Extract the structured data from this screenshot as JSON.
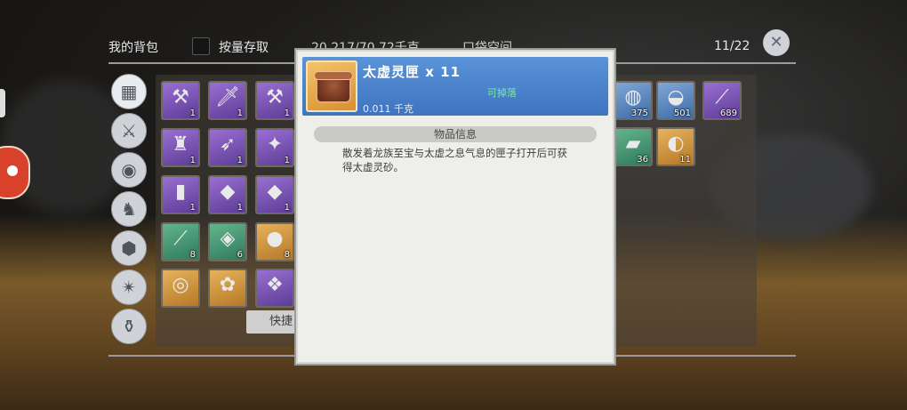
{
  "header": {
    "title": "我的背包",
    "check_label": "按量存取",
    "weight": "20.217/70.72千克",
    "capacity": "口袋空间",
    "count": "11/22",
    "close_icon": "close-x-icon"
  },
  "categories": [
    {
      "name": "all",
      "icon": "grid-icon",
      "glyph": "▦"
    },
    {
      "name": "weapon",
      "icon": "weapon-icon",
      "glyph": "⚔"
    },
    {
      "name": "food",
      "icon": "meat-icon",
      "glyph": "◉"
    },
    {
      "name": "mount",
      "icon": "horse-icon",
      "glyph": "♞"
    },
    {
      "name": "material",
      "icon": "stone-icon",
      "glyph": "⬢"
    },
    {
      "name": "gem",
      "icon": "crystal-icon",
      "glyph": "✴"
    },
    {
      "name": "bag",
      "icon": "bag-icon",
      "glyph": "⚱"
    }
  ],
  "inventory": [
    {
      "icon": "double-axe-icon",
      "glyph": "⚒",
      "qty": "1",
      "rarity": "purple"
    },
    {
      "icon": "greatsword-icon",
      "glyph": "🗡",
      "qty": "1",
      "rarity": "purple"
    },
    {
      "icon": "axe-icon",
      "glyph": "⚒",
      "qty": "1",
      "rarity": "purple"
    },
    {
      "icon": "tower-icon",
      "glyph": "♜",
      "qty": "1",
      "rarity": "purple"
    },
    {
      "icon": "bow-icon",
      "glyph": "➶",
      "qty": "1",
      "rarity": "purple"
    },
    {
      "icon": "staff-icon",
      "glyph": "✦",
      "qty": "1",
      "rarity": "purple"
    },
    {
      "icon": "leg-armor-icon",
      "glyph": "▮",
      "qty": "1",
      "rarity": "purple"
    },
    {
      "icon": "purple-gem-icon",
      "glyph": "◆",
      "qty": "1",
      "rarity": "purple"
    },
    {
      "icon": "purple-gem-icon",
      "glyph": "◆",
      "qty": "1",
      "rarity": "purple"
    },
    {
      "icon": "spear-icon",
      "glyph": "⟋",
      "qty": "8",
      "rarity": "green"
    },
    {
      "icon": "crystal-shard-icon",
      "glyph": "◈",
      "qty": "6",
      "rarity": "green"
    },
    {
      "icon": "orb-icon",
      "glyph": "●",
      "qty": "8",
      "rarity": "gold"
    },
    {
      "icon": "gold-coin-icon",
      "glyph": "◎",
      "qty": "",
      "rarity": "gold"
    },
    {
      "icon": "flower-gem-icon",
      "glyph": "✿",
      "qty": "",
      "rarity": "gold"
    },
    {
      "icon": "purple-crystal-icon",
      "glyph": "❖",
      "qty": "",
      "rarity": "purple"
    },
    {
      "icon": "pastry-icon",
      "glyph": "◍",
      "qty": "375",
      "rarity": "blue"
    },
    {
      "icon": "food-bowl-icon",
      "glyph": "◒",
      "qty": "501",
      "rarity": "blue"
    },
    {
      "icon": "trident-icon",
      "glyph": "⟋",
      "qty": "689",
      "rarity": "purple"
    },
    {
      "icon": "bread-icon",
      "glyph": "▰",
      "qty": "36",
      "rarity": "green"
    },
    {
      "icon": "wooden-box-icon",
      "glyph": "◐",
      "qty": "11",
      "rarity": "gold"
    }
  ],
  "quick_button": "快捷",
  "tooltip": {
    "name": "太虚灵匣 x 11",
    "drop": "可掉落",
    "weight": "0.011 千克",
    "section": "物品信息",
    "description": "散发着龙族至宝与太虚之息气息的匣子打开后可获得太虚灵砂。",
    "item_icon": "wooden-box-icon"
  }
}
